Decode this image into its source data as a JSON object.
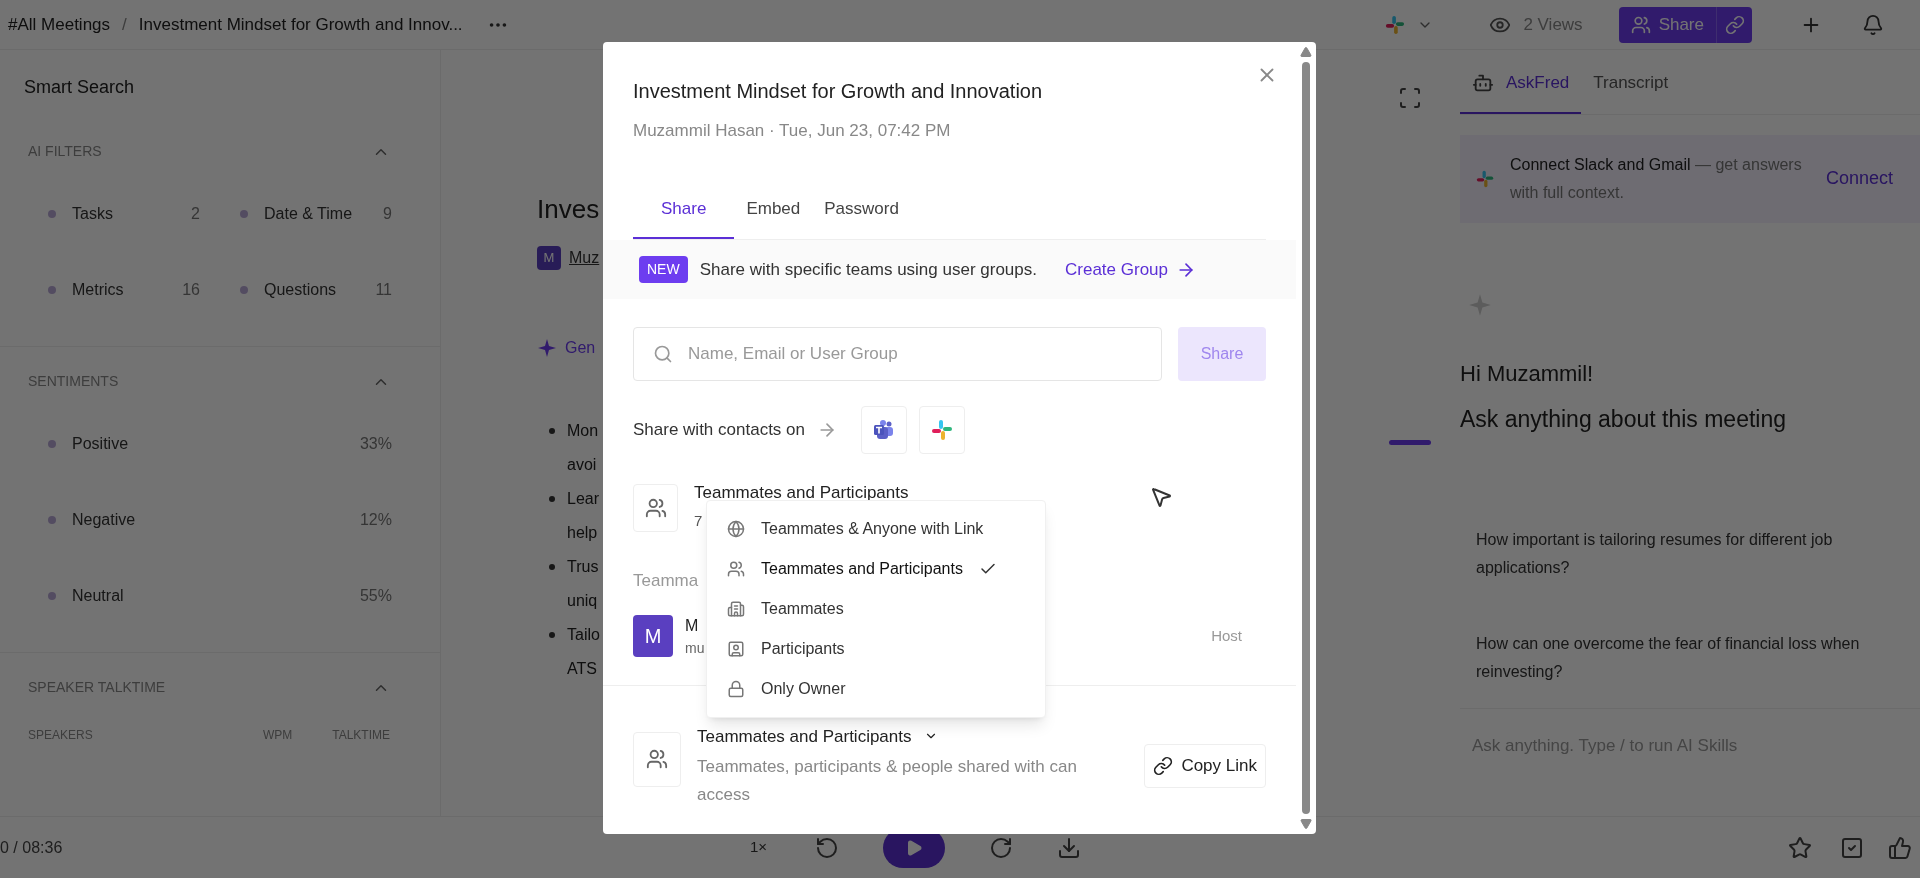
{
  "top_bar": {
    "breadcrumb_root": "#All Meetings",
    "separator": "/",
    "meeting_title": "Investment Mindset for Growth and Innov...",
    "views": "2 Views",
    "share_button": "Share"
  },
  "left_panel": {
    "title": "Smart Search",
    "sections": [
      {
        "title": "AI FILTERS",
        "expanded": true,
        "kind": "grid",
        "items": [
          {
            "label": "Tasks",
            "count": "2"
          },
          {
            "label": "Date & Time",
            "count": "9"
          },
          {
            "label": "Metrics",
            "count": "16"
          },
          {
            "label": "Questions",
            "count": "11"
          }
        ]
      },
      {
        "title": "SENTIMENTS",
        "expanded": true,
        "kind": "list",
        "items": [
          {
            "label": "Positive",
            "count": "33%"
          },
          {
            "label": "Negative",
            "count": "12%"
          },
          {
            "label": "Neutral",
            "count": "55%"
          }
        ]
      },
      {
        "title": "SPEAKER TALKTIME",
        "expanded": true,
        "kind": "table",
        "columns": [
          "SPEAKERS",
          "WPM",
          "TALKTIME"
        ]
      }
    ]
  },
  "main": {
    "heading": "Inves",
    "host_initial": "M",
    "host_name": "Muz",
    "generate_label": "Gen",
    "bullets": [
      {
        "lines": [
          "Mon",
          "avoi"
        ]
      },
      {
        "lines": [
          "Lear",
          "help"
        ]
      },
      {
        "lines": [
          "Trus",
          "uniq"
        ]
      },
      {
        "lines": [
          "Tailo",
          "ATS"
        ]
      }
    ]
  },
  "player": {
    "time": "0 / 08:36",
    "speed": "1×"
  },
  "right_panel": {
    "tabs": [
      {
        "label": "AskFred",
        "selected": true
      },
      {
        "label": "Transcript",
        "selected": false
      }
    ],
    "banner": {
      "lead": "Connect Slack and Gmail",
      "rest": " — get answers with full context.",
      "action": "Connect"
    },
    "greeting": "Hi Muzammil!",
    "prompt": "Ask anything about this meeting",
    "suggestions": [
      "How important is tailoring resumes for different job applications?",
      "How can one overcome the fear of financial loss when reinvesting?"
    ],
    "input": {
      "placeholder": "Ask anything. Type / to run AI Skills"
    }
  },
  "modal": {
    "title": "Investment Mindset for Growth and Innovation",
    "subtitle": "Muzammil Hasan · Tue, Jun 23, 07:42 PM",
    "tabs": [
      {
        "label": "Share",
        "selected": true
      },
      {
        "label": "Embed",
        "selected": false
      },
      {
        "label": "Password",
        "selected": false
      }
    ],
    "notice": {
      "badge": "NEW",
      "text": "Share with specific teams using user groups.",
      "link": "Create Group"
    },
    "search": {
      "placeholder": "Name, Email or User Group"
    },
    "share_button": {
      "label": "Share",
      "disabled": true
    },
    "contacts_label": "Share with contacts on",
    "access_row": {
      "title": "Teammates and Participants",
      "detail": "7"
    },
    "dropdown": [
      {
        "label": "Teammates & Anyone with Link",
        "selected": false
      },
      {
        "label": "Teammates and Participants",
        "selected": true
      },
      {
        "label": "Teammates",
        "selected": false
      },
      {
        "label": "Participants",
        "selected": false
      },
      {
        "label": "Only Owner",
        "selected": false
      }
    ],
    "members_heading": "Teamma",
    "members": [
      {
        "initial": "M",
        "name": "M",
        "email": "mu",
        "role": "Host"
      }
    ],
    "link_access": {
      "title": "Teammates and Participants",
      "description": "Teammates, participants & people shared with can access",
      "copy_button": "Copy Link"
    }
  }
}
